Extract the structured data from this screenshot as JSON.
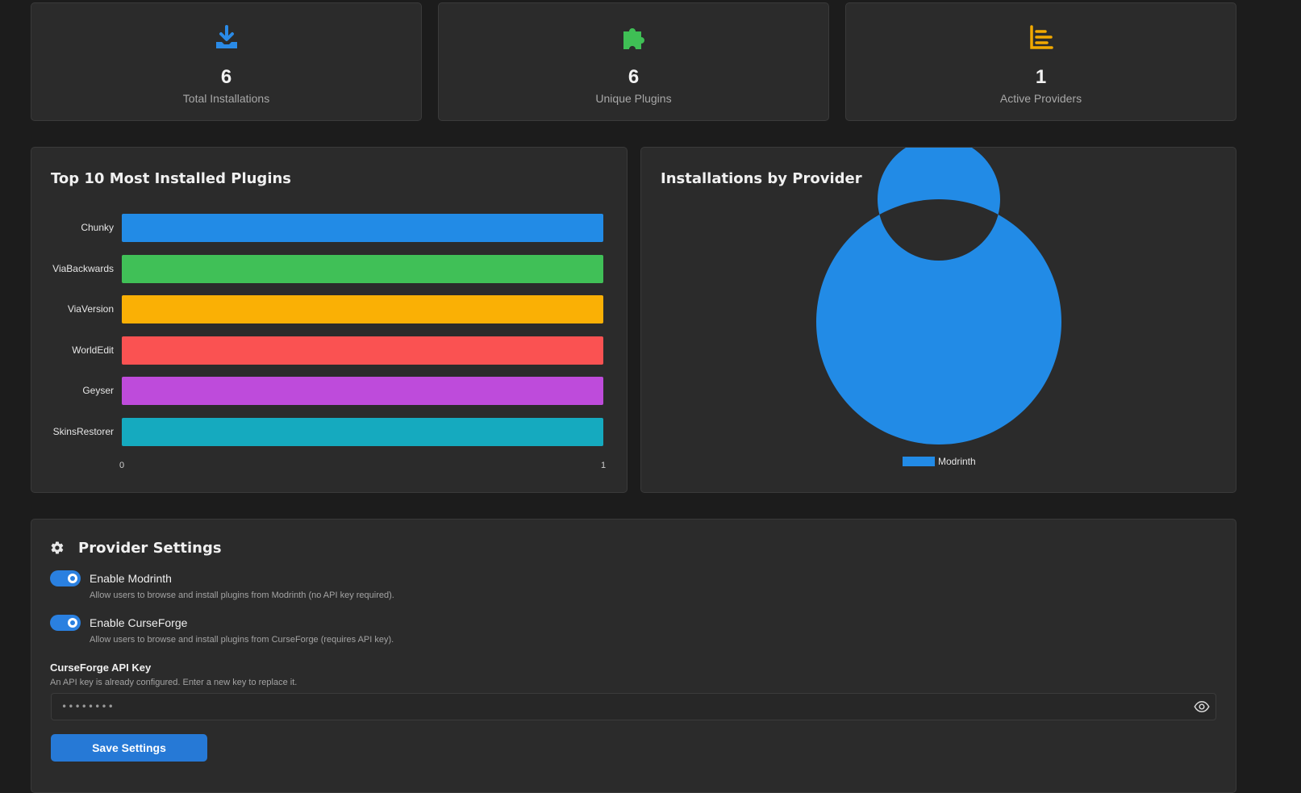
{
  "stats": [
    {
      "value": "6",
      "label": "Total Installations",
      "icon": "download-icon",
      "color": "#2a8ae6"
    },
    {
      "value": "6",
      "label": "Unique Plugins",
      "icon": "puzzle-icon",
      "color": "#3fbf55"
    },
    {
      "value": "1",
      "label": "Active Providers",
      "icon": "list-icon",
      "color": "#f2a900"
    }
  ],
  "chart_data": [
    {
      "type": "bar",
      "orientation": "horizontal",
      "title": "Top 10 Most Installed Plugins",
      "categories": [
        "Chunky",
        "ViaBackwards",
        "ViaVersion",
        "WorldEdit",
        "Geyser",
        "SkinsRestorer"
      ],
      "values": [
        1,
        1,
        1,
        1,
        1,
        1
      ],
      "colors": [
        "#228be6",
        "#40c057",
        "#fab005",
        "#fa5252",
        "#be4bdb",
        "#15aabf"
      ],
      "xlim": [
        0,
        1
      ],
      "x_ticks": [
        "0",
        "1"
      ]
    },
    {
      "type": "pie",
      "variant": "doughnut",
      "title": "Installations by Provider",
      "labels": [
        "Modrinth"
      ],
      "values": [
        6
      ],
      "colors": [
        "#228be6"
      ],
      "legend": "bottom"
    }
  ],
  "settings": {
    "title": "Provider Settings",
    "icon": "gear-icon",
    "modrinth": {
      "label": "Enable Modrinth",
      "description": "Allow users to browse and install plugins from Modrinth (no API key required).",
      "enabled": true
    },
    "curseforge": {
      "label": "Enable CurseForge",
      "description": "Allow users to browse and install plugins from CurseForge (requires API key).",
      "enabled": true
    },
    "api_key": {
      "label": "CurseForge API Key",
      "hint": "An API key is already configured. Enter a new key to replace it.",
      "value": "••••••••"
    },
    "save_label": "Save Settings"
  }
}
